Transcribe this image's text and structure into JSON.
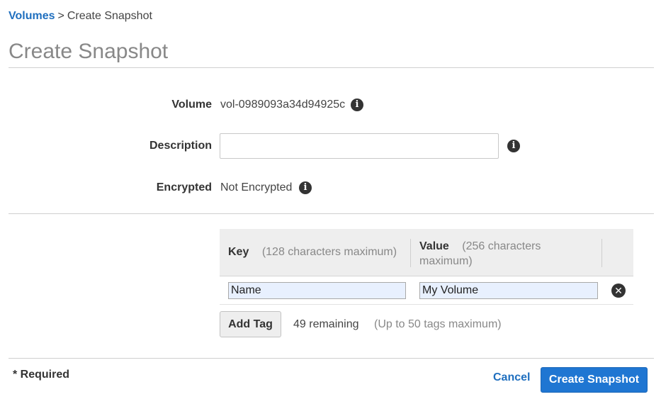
{
  "breadcrumb": {
    "parent": "Volumes",
    "separator": ">",
    "current": "Create Snapshot"
  },
  "page": {
    "title": "Create Snapshot"
  },
  "form": {
    "volume_label": "Volume",
    "volume_value": "vol-0989093a34d94925c",
    "description_label": "Description",
    "description_value": "",
    "encrypted_label": "Encrypted",
    "encrypted_value": "Not Encrypted"
  },
  "tags": {
    "key_header": "Key",
    "key_note": "(128 characters maximum)",
    "value_header": "Value",
    "value_note": "(256 characters maximum)",
    "rows": [
      {
        "key": "Name",
        "value": "My Volume"
      }
    ],
    "add_button": "Add Tag",
    "remaining": "49 remaining",
    "max_note": "(Up to 50 tags maximum)"
  },
  "footer": {
    "required": "* Required",
    "cancel": "Cancel",
    "submit": "Create Snapshot"
  },
  "icons": {
    "info": "info-icon",
    "remove": "close-circle-icon"
  },
  "colors": {
    "link": "#1f6fbf",
    "primary": "#1f76d2",
    "title": "#888888"
  }
}
